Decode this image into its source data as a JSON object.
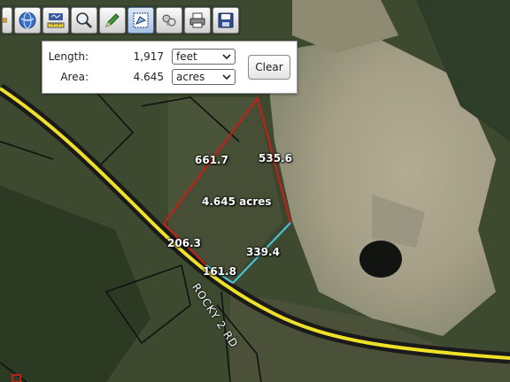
{
  "toolbar": {
    "tools": [
      {
        "icon": "globe-icon"
      },
      {
        "icon": "ruler-icon"
      },
      {
        "icon": "magnifier-icon"
      },
      {
        "icon": "pencil-icon"
      },
      {
        "icon": "measure-area-icon",
        "active": true
      },
      {
        "icon": "shapes-icon"
      },
      {
        "icon": "print-icon"
      },
      {
        "icon": "save-icon"
      }
    ]
  },
  "measure": {
    "length_label": "Length:",
    "length_value": "1,917",
    "length_unit": "feet",
    "area_label": "Area:",
    "area_value": "4.645",
    "area_unit": "acres",
    "clear_label": "Clear"
  },
  "map": {
    "edge_labels": {
      "left": "661.7",
      "right": "535.6",
      "lower_right": "339.4",
      "lower_left": "206.3",
      "bottom": "161.8"
    },
    "area_label": "4.645 acres",
    "road_label": "ROCKY 2 RD",
    "colors": {
      "polygon": "#c0201a",
      "polygon_highlight": "#42c3d6",
      "road": "#efe02a",
      "parcel": "#111111"
    }
  }
}
